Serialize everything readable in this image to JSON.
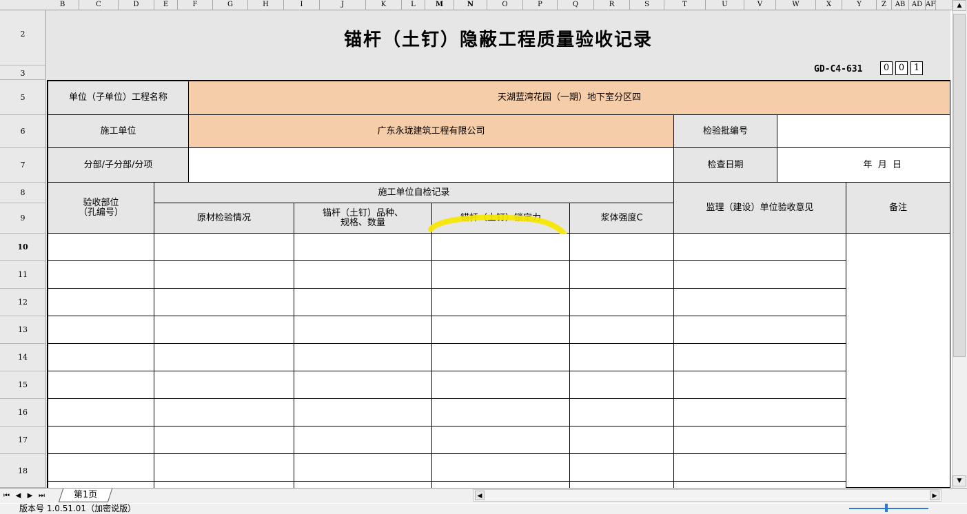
{
  "columns": [
    "B",
    "C",
    "D",
    "E",
    "F",
    "G",
    "H",
    "I",
    "J",
    "K",
    "L",
    "M",
    "N",
    "O",
    "P",
    "Q",
    "R",
    "S",
    "T",
    "U",
    "V",
    "W",
    "X",
    "Y",
    "Z",
    "AB",
    "AD",
    "AF"
  ],
  "selected_columns": [
    "M",
    "N"
  ],
  "rows": [
    "2",
    "3",
    "5",
    "6",
    "7",
    "8",
    "9",
    "10",
    "11",
    "12",
    "13",
    "14",
    "15",
    "16",
    "17",
    "18"
  ],
  "selected_row": "10",
  "form": {
    "title": "锚杆（土钉）隐蔽工程质量验收记录",
    "code_prefix": "GD-C4-631",
    "code_digits": [
      "0",
      "0",
      "1"
    ],
    "project_label": "单位（子单位）工程名称",
    "project_value": "天湖蓝湾花园（一期）地下室分区四",
    "contractor_label": "施工单位",
    "contractor_value": "广东永珑建筑工程有限公司",
    "batch_label": "检验批编号",
    "batch_value": "",
    "division_label": "分部/子分部/分项",
    "division_value": "",
    "date_label": "检查日期",
    "date_value": "年  月  日",
    "col_location": "验收部位\n（孔编号）",
    "col_self_check": "施工单位自检记录",
    "col_material": "原材检验情况",
    "col_variety": "锚杆（土钉）品种、\n规格、数量",
    "col_lock_force": "锚杆（土钉）锁定力",
    "col_grout": "浆体强度C",
    "col_supervision": "监理（建设）单位验收意见",
    "col_remark": "备注"
  },
  "tabs": {
    "sheet1": "第1页"
  },
  "status": {
    "version": "版本号 1.0.51.01（加密说版）"
  },
  "colors": {
    "header_fill": "#e6e6e6",
    "highlight_fill": "#f5cda8",
    "annotation": "#f7e600"
  }
}
